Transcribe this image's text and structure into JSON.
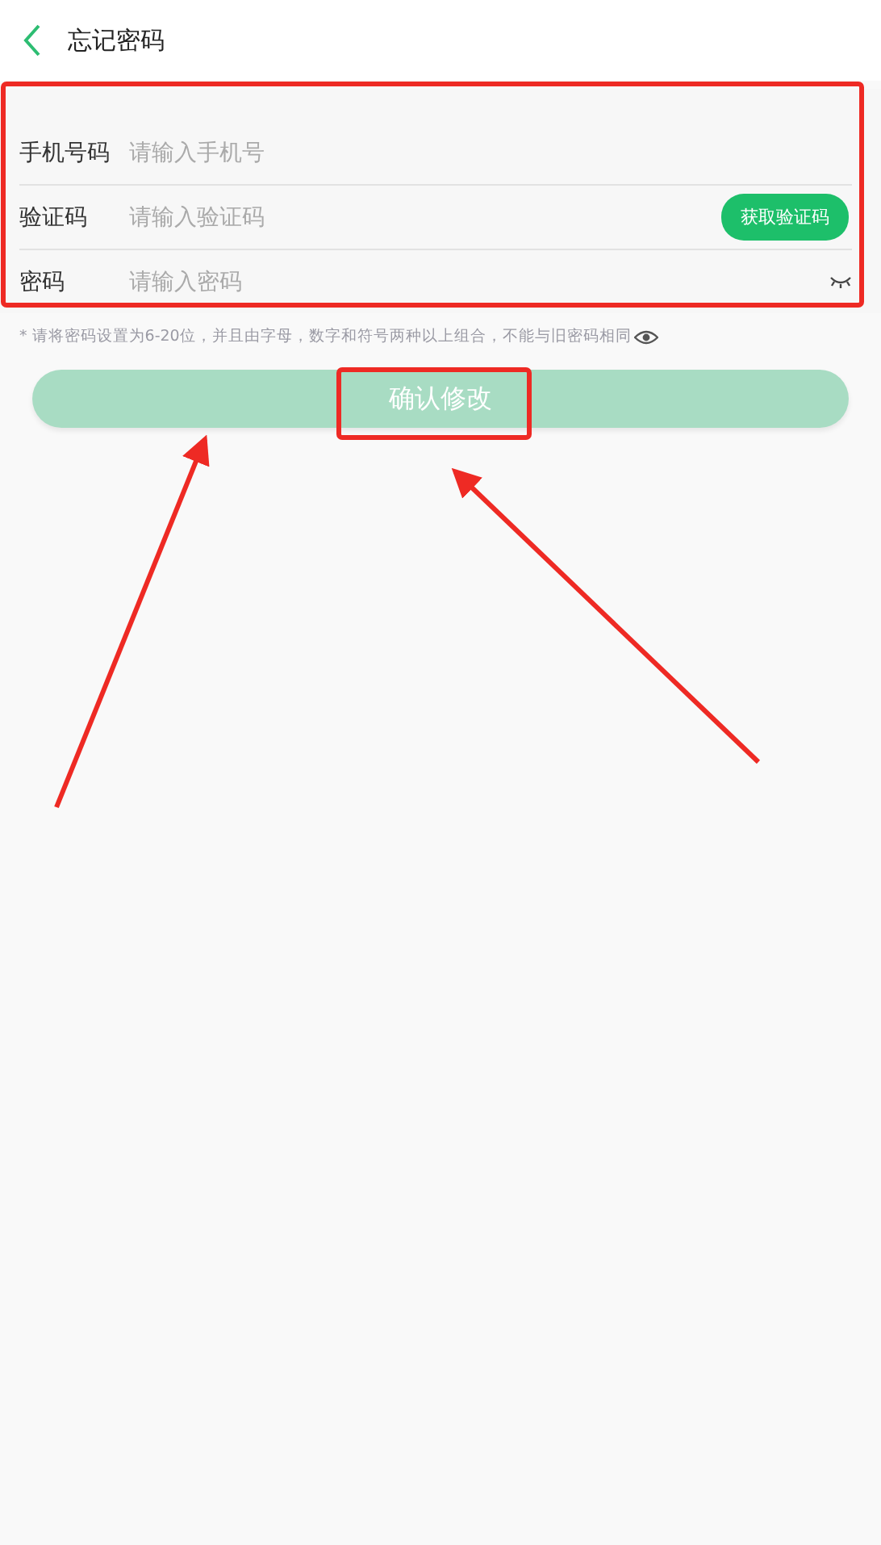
{
  "header": {
    "title": "忘记密码"
  },
  "form": {
    "rows": [
      {
        "kind": "text",
        "label": "手机号码",
        "placeholder": "请输入手机号"
      },
      {
        "kind": "code",
        "label": "验证码",
        "placeholder": "请输入验证码",
        "action": "获取验证码"
      },
      {
        "kind": "password",
        "label": "密码",
        "placeholder": "请输入密码"
      }
    ]
  },
  "hint": "* 请将密码设置为6-20位，并且由字母，数字和符号两种以上组合，不能与旧密码相同",
  "submit": {
    "label": "确认修改",
    "disabled": true
  }
}
